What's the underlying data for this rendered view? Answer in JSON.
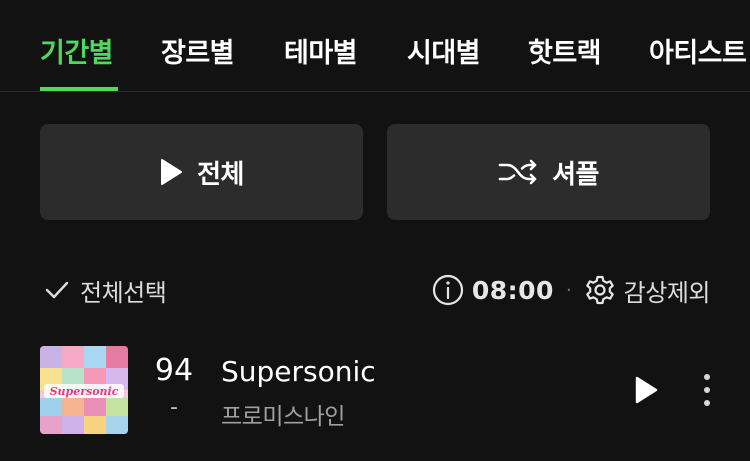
{
  "tabs": [
    {
      "label": "기간별",
      "active": true
    },
    {
      "label": "장르별",
      "active": false
    },
    {
      "label": "테마별",
      "active": false
    },
    {
      "label": "시대별",
      "active": false
    },
    {
      "label": "핫트랙",
      "active": false
    },
    {
      "label": "아티스트",
      "active": false
    }
  ],
  "actions": {
    "play_all": {
      "label": "전체",
      "icon": "play-icon"
    },
    "shuffle": {
      "label": "셔플",
      "icon": "shuffle-icon"
    }
  },
  "controls": {
    "select_all_label": "전체선택",
    "select_all_icon": "checkmark-icon",
    "timer_icon": "info-icon",
    "timer_value": "08:00",
    "separator": "·",
    "exclude_icon": "gear-icon",
    "exclude_label": "감상제외"
  },
  "songs": [
    {
      "rank": "94",
      "rank_change": "-",
      "title": "Supersonic",
      "artist": "프로미스나인",
      "album_art_text": "Supersonic"
    }
  ],
  "colors": {
    "accent": "#4ed95c",
    "background": "#121212",
    "button_bg": "#2c2c2c",
    "text_primary": "#ffffff",
    "text_secondary": "#a0a0a0"
  }
}
